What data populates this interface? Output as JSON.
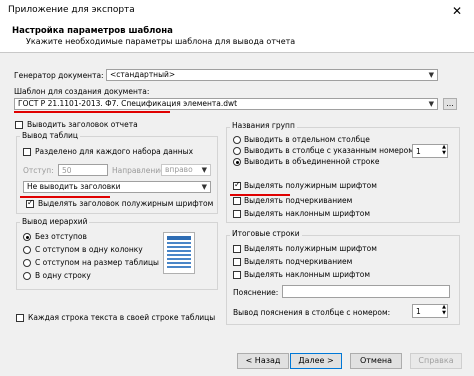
{
  "window": {
    "title": "Приложение для экспорта",
    "close_glyph": "✕"
  },
  "header": {
    "title": "Настройка параметров шаблона",
    "subtitle": "Укажите необходимые параметры шаблона для вывода отчета"
  },
  "generator": {
    "label": "Генератор документа:",
    "value": "<стандартный>"
  },
  "template": {
    "label": "Шаблон для создания документа:",
    "value": "ГОСТ Р 21.1101-2013. Ф7. Спецификация элемента.dwt",
    "browse": "..."
  },
  "output_title": {
    "label": "Выводить заголовок отчета",
    "checked": false
  },
  "table_output": {
    "group_label": "Вывод таблиц",
    "split": {
      "label": "Разделено для каждого набора данных",
      "checked": false
    },
    "indent_label": "Отступ:",
    "indent_value": "50",
    "direction_label": "Направление:",
    "direction_value": "вправо",
    "header_mode": "Не выводить заголовки",
    "bold_header": {
      "label": "Выделять заголовок полужирным шрифтом",
      "checked": true
    }
  },
  "hierarchy": {
    "group_label": "Вывод иерархий",
    "options": [
      {
        "label": "Без отступов",
        "selected": true
      },
      {
        "label": "С отступом в одну колонку",
        "selected": false
      },
      {
        "label": "С отступом на размер таблицы",
        "selected": false
      },
      {
        "label": "В одну строку",
        "selected": false
      }
    ]
  },
  "each_row": {
    "label": "Каждая строка текста в своей строке таблицы",
    "checked": false
  },
  "group_names": {
    "group_label": "Названия групп",
    "options": [
      {
        "label": "Выводить в отдельном столбце",
        "selected": false
      },
      {
        "label": "Выводить в столбце с указанным  номером",
        "selected": false
      },
      {
        "label": "Выводить в объединенной строке",
        "selected": true
      }
    ],
    "column_number": "1",
    "checks": [
      {
        "label": "Выделять полужирным шрифтом",
        "checked": true
      },
      {
        "label": "Выделять подчеркиванием",
        "checked": false
      },
      {
        "label": "Выделять наклонным шрифтом",
        "checked": false
      }
    ]
  },
  "totals": {
    "group_label": "Итоговые строки",
    "checks": [
      {
        "label": "Выделять полужирным шрифтом",
        "checked": false
      },
      {
        "label": "Выделять подчеркиванием",
        "checked": false
      },
      {
        "label": "Выделять наклонным шрифтом",
        "checked": false
      }
    ],
    "explanation_label": "Пояснение:",
    "explanation_value": "",
    "expl_column_label": "Вывод пояснения в столбце с номером:",
    "expl_column_value": "1"
  },
  "footer": {
    "back": "< Назад",
    "next": "Далее >",
    "cancel": "Отмена",
    "help": "Справка"
  },
  "colors": {
    "annotation_red": "#e00000",
    "accent_blue": "#0078d7"
  }
}
